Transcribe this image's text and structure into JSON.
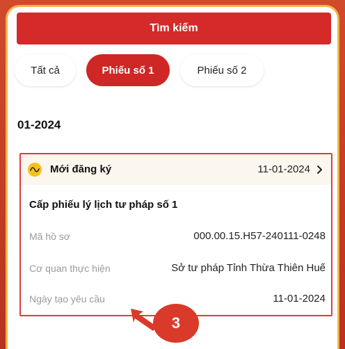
{
  "search": {
    "label": "Tìm kiếm"
  },
  "tabs": [
    {
      "label": "Tất cả",
      "active": false
    },
    {
      "label": "Phiếu số 1",
      "active": true
    },
    {
      "label": "Phiếu số 2",
      "active": false
    }
  ],
  "month_heading": "01-2024",
  "record": {
    "status": "Mới đăng ký",
    "status_icon": "activity-wave-icon",
    "date": "11-01-2024",
    "title": "Cấp phiếu lý lịch tư pháp số 1",
    "fields": [
      {
        "label": "Mã hồ sơ",
        "value": "000.00.15.H57-240111-0248"
      },
      {
        "label": "Cơ quan thực hiện",
        "value": "Sở tư pháp Tỉnh Thừa Thiên Huế"
      },
      {
        "label": "Ngày tạo yêu cầu",
        "value": "11-01-2024"
      }
    ]
  },
  "annotation": {
    "number": "3"
  },
  "colors": {
    "accent": "#d42a2a",
    "status_yellow": "#f6c21a",
    "highlight_border": "#e23b3b"
  }
}
